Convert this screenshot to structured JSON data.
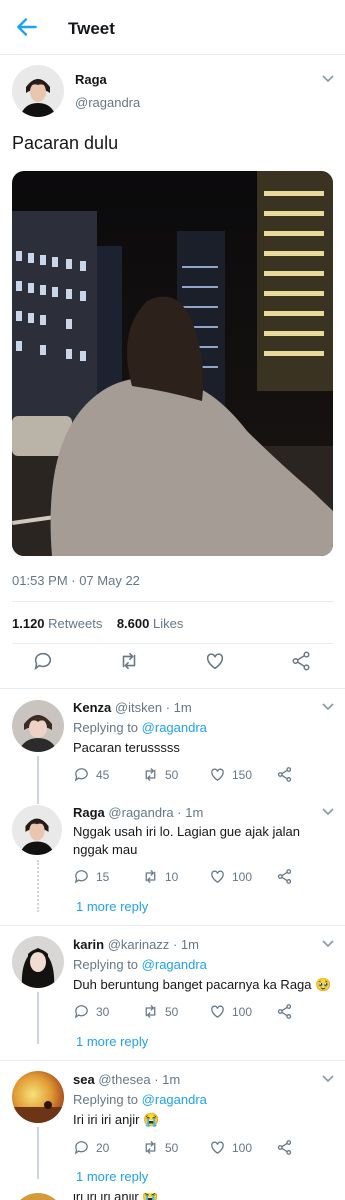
{
  "header": {
    "title": "Tweet",
    "back_icon": "back-arrow-icon",
    "accent": "#1da1f2"
  },
  "tweet": {
    "name": "Raga",
    "handle": "@ragandra",
    "text": "Pacaran dulu",
    "timestamp": "01:53 PM · 07 May 22",
    "retweets_count": "1.120",
    "retweets_label": "Retweets",
    "likes_count": "8.600",
    "likes_label": "Likes"
  },
  "replies": [
    {
      "name": "Kenza",
      "handle": "@itsken",
      "time": "· 1m",
      "replying_prefix": "Replying to",
      "replying_to": "@ragandra",
      "text": "Pacaran terusssss",
      "counts": {
        "reply": "45",
        "retweet": "50",
        "like": "150"
      }
    },
    {
      "name": "Raga",
      "handle": "@ragandra",
      "time": "· 1m",
      "text_line1": "Nggak usah iri lo. Lagian gue ajak jalan",
      "text_line2": "nggak mau",
      "counts": {
        "reply": "15",
        "retweet": "10",
        "like": "100"
      },
      "more_replies": "1 more reply"
    },
    {
      "name": "karin",
      "handle": "@karinazz",
      "time": "· 1m",
      "replying_prefix": "Replying to",
      "replying_to": "@ragandra",
      "text": "Duh beruntung banget pacarnya ka Raga 🥹",
      "counts": {
        "reply": "30",
        "retweet": "50",
        "like": "100"
      },
      "more_replies": "1 more reply"
    },
    {
      "name": "sea",
      "handle": "@thesea",
      "time": "· 1m",
      "replying_prefix": "Replying to",
      "replying_to": "@ragandra",
      "text": "Iri iri iri anjir 😭",
      "counts": {
        "reply": "20",
        "retweet": "50",
        "like": "100"
      },
      "more_replies": "1 more reply"
    }
  ],
  "peek_text": "iri iri iri anjir 😭"
}
